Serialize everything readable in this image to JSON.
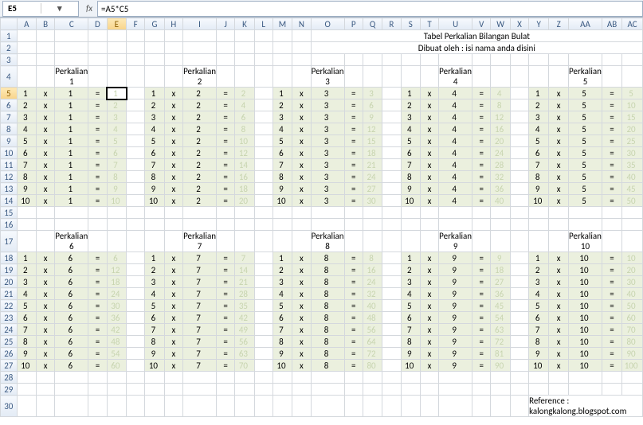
{
  "formula_bar": {
    "cell_ref": "E5",
    "fx_label": "fx",
    "formula": "=A5*C5"
  },
  "title": "Tabel Perkalian Bilangan Bulat",
  "subtitle": "Dibuat oleh : isi nama anda disini",
  "reference": "Reference : kalongkalong.blogspot.com",
  "columns": [
    "A",
    "B",
    "C",
    "D",
    "E",
    "F",
    "G",
    "H",
    "I",
    "J",
    "K",
    "L",
    "M",
    "N",
    "O",
    "P",
    "Q",
    "R",
    "S",
    "T",
    "U",
    "V",
    "W",
    "X",
    "Y",
    "Z",
    "AA",
    "AB",
    "AC"
  ],
  "row_numbers_visible": [
    1,
    2,
    3,
    4,
    5,
    6,
    7,
    8,
    9,
    10,
    11,
    12,
    13,
    14,
    15,
    16,
    17,
    18,
    19,
    20,
    21,
    22,
    23,
    24,
    25,
    26,
    27,
    28,
    29,
    30
  ],
  "selected_cell": {
    "col": "E",
    "row": 5
  },
  "blocks_top": [
    {
      "title": "Perkalian 1",
      "rows": [
        [
          "1",
          "x",
          "1",
          "=",
          "1"
        ],
        [
          "2",
          "x",
          "1",
          "=",
          "2"
        ],
        [
          "3",
          "x",
          "1",
          "=",
          "3"
        ],
        [
          "4",
          "x",
          "1",
          "=",
          "4"
        ],
        [
          "5",
          "x",
          "1",
          "=",
          "5"
        ],
        [
          "6",
          "x",
          "1",
          "=",
          "6"
        ],
        [
          "7",
          "x",
          "1",
          "=",
          "7"
        ],
        [
          "8",
          "x",
          "1",
          "=",
          "8"
        ],
        [
          "9",
          "x",
          "1",
          "=",
          "9"
        ],
        [
          "10",
          "x",
          "1",
          "=",
          "10"
        ]
      ]
    },
    {
      "title": "Perkalian 2",
      "rows": [
        [
          "1",
          "x",
          "2",
          "=",
          "2"
        ],
        [
          "2",
          "x",
          "2",
          "=",
          "4"
        ],
        [
          "3",
          "x",
          "2",
          "=",
          "6"
        ],
        [
          "4",
          "x",
          "2",
          "=",
          "8"
        ],
        [
          "5",
          "x",
          "2",
          "=",
          "10"
        ],
        [
          "6",
          "x",
          "2",
          "=",
          "12"
        ],
        [
          "7",
          "x",
          "2",
          "=",
          "14"
        ],
        [
          "8",
          "x",
          "2",
          "=",
          "16"
        ],
        [
          "9",
          "x",
          "2",
          "=",
          "18"
        ],
        [
          "10",
          "x",
          "2",
          "=",
          "20"
        ]
      ]
    },
    {
      "title": "Perkalian 3",
      "rows": [
        [
          "1",
          "x",
          "3",
          "=",
          "3"
        ],
        [
          "2",
          "x",
          "3",
          "=",
          "6"
        ],
        [
          "3",
          "x",
          "3",
          "=",
          "9"
        ],
        [
          "4",
          "x",
          "3",
          "=",
          "12"
        ],
        [
          "5",
          "x",
          "3",
          "=",
          "15"
        ],
        [
          "6",
          "x",
          "3",
          "=",
          "18"
        ],
        [
          "7",
          "x",
          "3",
          "=",
          "21"
        ],
        [
          "8",
          "x",
          "3",
          "=",
          "24"
        ],
        [
          "9",
          "x",
          "3",
          "=",
          "27"
        ],
        [
          "10",
          "x",
          "3",
          "=",
          "30"
        ]
      ]
    },
    {
      "title": "Perkalian 4",
      "rows": [
        [
          "1",
          "x",
          "4",
          "=",
          "4"
        ],
        [
          "2",
          "x",
          "4",
          "=",
          "8"
        ],
        [
          "3",
          "x",
          "4",
          "=",
          "12"
        ],
        [
          "4",
          "x",
          "4",
          "=",
          "16"
        ],
        [
          "5",
          "x",
          "4",
          "=",
          "20"
        ],
        [
          "6",
          "x",
          "4",
          "=",
          "24"
        ],
        [
          "7",
          "x",
          "4",
          "=",
          "28"
        ],
        [
          "8",
          "x",
          "4",
          "=",
          "32"
        ],
        [
          "9",
          "x",
          "4",
          "=",
          "36"
        ],
        [
          "10",
          "x",
          "4",
          "=",
          "40"
        ]
      ]
    },
    {
      "title": "Perkalian 5",
      "rows": [
        [
          "1",
          "x",
          "5",
          "=",
          "5"
        ],
        [
          "2",
          "x",
          "5",
          "=",
          "10"
        ],
        [
          "3",
          "x",
          "5",
          "=",
          "15"
        ],
        [
          "4",
          "x",
          "5",
          "=",
          "20"
        ],
        [
          "5",
          "x",
          "5",
          "=",
          "25"
        ],
        [
          "6",
          "x",
          "5",
          "=",
          "30"
        ],
        [
          "7",
          "x",
          "5",
          "=",
          "35"
        ],
        [
          "8",
          "x",
          "5",
          "=",
          "40"
        ],
        [
          "9",
          "x",
          "5",
          "=",
          "45"
        ],
        [
          "10",
          "x",
          "5",
          "=",
          "50"
        ]
      ]
    }
  ],
  "blocks_bottom": [
    {
      "title": "Perkalian 6",
      "rows": [
        [
          "1",
          "x",
          "6",
          "=",
          "6"
        ],
        [
          "2",
          "x",
          "6",
          "=",
          "12"
        ],
        [
          "3",
          "x",
          "6",
          "=",
          "18"
        ],
        [
          "4",
          "x",
          "6",
          "=",
          "24"
        ],
        [
          "5",
          "x",
          "6",
          "=",
          "30"
        ],
        [
          "6",
          "x",
          "6",
          "=",
          "36"
        ],
        [
          "7",
          "x",
          "6",
          "=",
          "42"
        ],
        [
          "8",
          "x",
          "6",
          "=",
          "48"
        ],
        [
          "9",
          "x",
          "6",
          "=",
          "54"
        ],
        [
          "10",
          "x",
          "6",
          "=",
          "60"
        ]
      ]
    },
    {
      "title": "Perkalian 7",
      "rows": [
        [
          "1",
          "x",
          "7",
          "=",
          "7"
        ],
        [
          "2",
          "x",
          "7",
          "=",
          "14"
        ],
        [
          "3",
          "x",
          "7",
          "=",
          "21"
        ],
        [
          "4",
          "x",
          "7",
          "=",
          "28"
        ],
        [
          "5",
          "x",
          "7",
          "=",
          "35"
        ],
        [
          "6",
          "x",
          "7",
          "=",
          "42"
        ],
        [
          "7",
          "x",
          "7",
          "=",
          "49"
        ],
        [
          "8",
          "x",
          "7",
          "=",
          "56"
        ],
        [
          "9",
          "x",
          "7",
          "=",
          "63"
        ],
        [
          "10",
          "x",
          "7",
          "=",
          "70"
        ]
      ]
    },
    {
      "title": "Perkalian 8",
      "rows": [
        [
          "1",
          "x",
          "8",
          "=",
          "8"
        ],
        [
          "2",
          "x",
          "8",
          "=",
          "16"
        ],
        [
          "3",
          "x",
          "8",
          "=",
          "24"
        ],
        [
          "4",
          "x",
          "8",
          "=",
          "32"
        ],
        [
          "5",
          "x",
          "8",
          "=",
          "40"
        ],
        [
          "6",
          "x",
          "8",
          "=",
          "48"
        ],
        [
          "7",
          "x",
          "8",
          "=",
          "56"
        ],
        [
          "8",
          "x",
          "8",
          "=",
          "64"
        ],
        [
          "9",
          "x",
          "8",
          "=",
          "72"
        ],
        [
          "10",
          "x",
          "8",
          "=",
          "80"
        ]
      ]
    },
    {
      "title": "Perkalian 9",
      "rows": [
        [
          "1",
          "x",
          "9",
          "=",
          "9"
        ],
        [
          "2",
          "x",
          "9",
          "=",
          "18"
        ],
        [
          "3",
          "x",
          "9",
          "=",
          "27"
        ],
        [
          "4",
          "x",
          "9",
          "=",
          "36"
        ],
        [
          "5",
          "x",
          "9",
          "=",
          "45"
        ],
        [
          "6",
          "x",
          "9",
          "=",
          "54"
        ],
        [
          "7",
          "x",
          "9",
          "=",
          "63"
        ],
        [
          "8",
          "x",
          "9",
          "=",
          "72"
        ],
        [
          "9",
          "x",
          "9",
          "=",
          "81"
        ],
        [
          "10",
          "x",
          "9",
          "=",
          "90"
        ]
      ]
    },
    {
      "title": "Perkalian 10",
      "rows": [
        [
          "1",
          "x",
          "10",
          "=",
          "10"
        ],
        [
          "2",
          "x",
          "10",
          "=",
          "20"
        ],
        [
          "3",
          "x",
          "10",
          "=",
          "30"
        ],
        [
          "4",
          "x",
          "10",
          "=",
          "40"
        ],
        [
          "5",
          "x",
          "10",
          "=",
          "50"
        ],
        [
          "6",
          "x",
          "10",
          "=",
          "60"
        ],
        [
          "7",
          "x",
          "10",
          "=",
          "70"
        ],
        [
          "8",
          "x",
          "10",
          "=",
          "80"
        ],
        [
          "9",
          "x",
          "10",
          "=",
          "90"
        ],
        [
          "10",
          "x",
          "10",
          "=",
          "100"
        ]
      ]
    }
  ]
}
